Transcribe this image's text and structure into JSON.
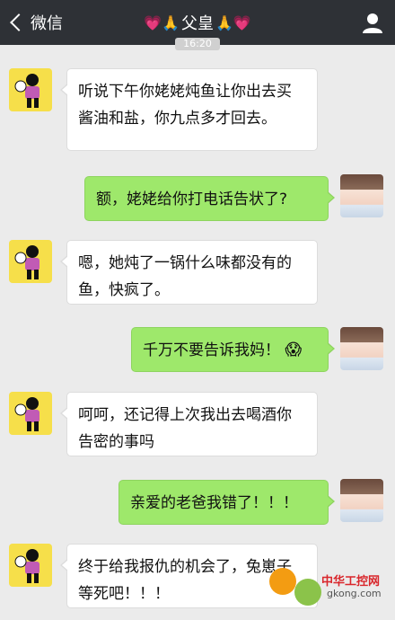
{
  "header": {
    "back_label": "微信",
    "title_prefix": "💗🙏",
    "title": "父皇",
    "title_suffix": "🙏💗",
    "timestamp": "16:20"
  },
  "messages": [
    {
      "side": "left",
      "text": "听说下午你姥姥炖鱼让你出去买酱油和盐，你九点多才回去。"
    },
    {
      "side": "right",
      "text": "额，姥姥给你打电话告状了?"
    },
    {
      "side": "left",
      "text": "嗯，她炖了一锅什么味都没有的鱼，快疯了。"
    },
    {
      "side": "right",
      "text": "千万不要告诉我妈！",
      "emoji": "😱"
    },
    {
      "side": "left",
      "text": "呵呵，还记得上次我出去喝酒你告密的事吗"
    },
    {
      "side": "right",
      "text": "亲爱的老爸我错了！！！"
    },
    {
      "side": "left",
      "text": "终于给我报仇的机会了，兔崽子等死吧！！！"
    }
  ],
  "watermark": {
    "cn": "中华工控网",
    "en": "gkong.com"
  },
  "colors": {
    "topbar": "#2e3136",
    "background": "#ebebeb",
    "bubble_left": "#ffffff",
    "bubble_right": "#9ee86b"
  }
}
